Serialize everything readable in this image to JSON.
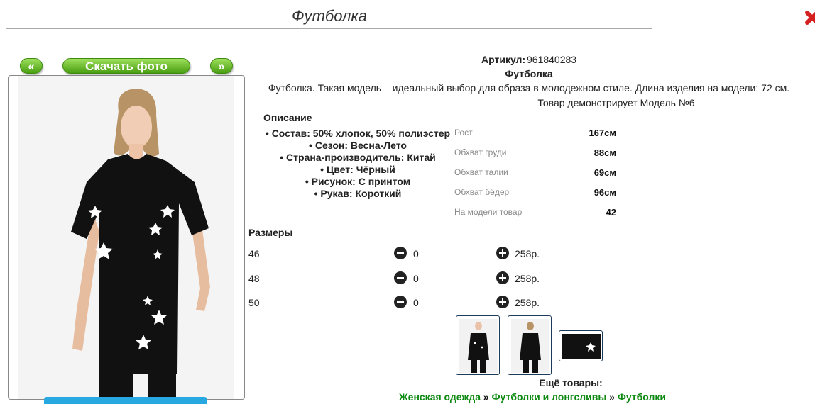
{
  "page": {
    "title": "Футболка"
  },
  "gallery": {
    "prev_label": "«",
    "download_label": "Скачать фото",
    "next_label": "»"
  },
  "product": {
    "article_label": "Артикул:",
    "article_value": "961840283",
    "name": "Футболка",
    "description": "Футболка. Такая модель – идеальный выбор для образа в молодежном стиле. Длина изделия на модели: 72 см.",
    "model_note": "Товар демонстрирует Модель №6"
  },
  "description": {
    "heading": "Описание",
    "items": [
      "Состав: 50% хлопок, 50% полиэстер",
      "Сезон: Весна-Лето",
      "Страна-производитель: Китай",
      "Цвет: Чёрный",
      "Рисунок: С принтом",
      "Рукав: Короткий"
    ]
  },
  "model_params": [
    {
      "label": "Рост",
      "value": "167см"
    },
    {
      "label": "Обхват груди",
      "value": "88см"
    },
    {
      "label": "Обхват талии",
      "value": "69см"
    },
    {
      "label": "Обхват бёдер",
      "value": "96см"
    },
    {
      "label": "На модели товар",
      "value": "42"
    }
  ],
  "sizes": {
    "heading": "Размеры",
    "rows": [
      {
        "size": "46",
        "qty": "0",
        "price": "258р."
      },
      {
        "size": "48",
        "qty": "0",
        "price": "258р."
      },
      {
        "size": "50",
        "qty": "0",
        "price": "258р."
      }
    ]
  },
  "more": {
    "heading": "Ещё товары:",
    "crumbs": [
      "Женская одежда",
      "Футболки и лонгсливы",
      "Футболки"
    ],
    "separator": "»"
  },
  "colors": {
    "accent_green": "#4a9e12",
    "link_green": "#0e8a12",
    "close_red": "#d42020"
  }
}
